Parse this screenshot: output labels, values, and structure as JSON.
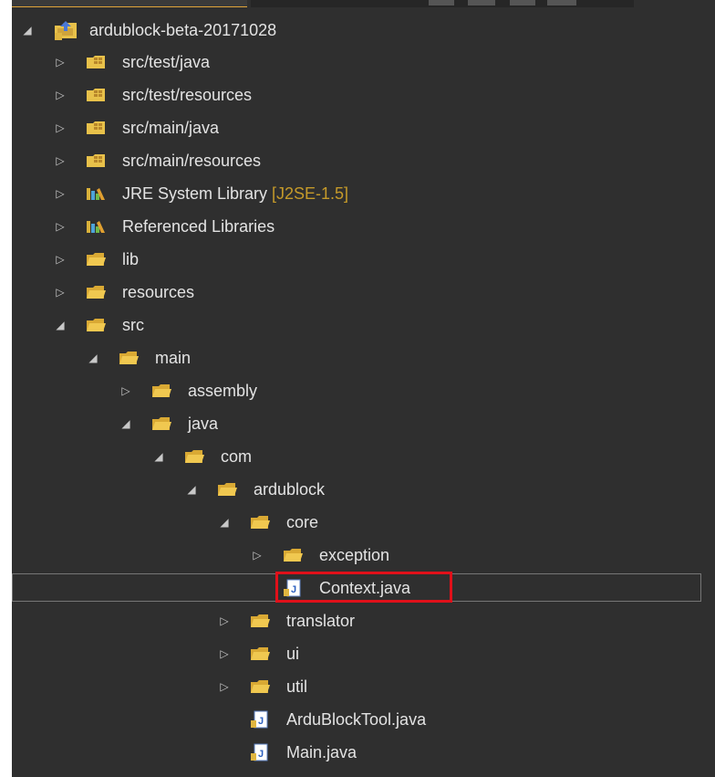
{
  "explorer": {
    "project": {
      "name": "ardublock-beta-20171028",
      "expanded": true
    },
    "rows": [
      {
        "label": "src/test/java",
        "icon": "package-folder-icon",
        "expanded": false
      },
      {
        "label": "src/test/resources",
        "icon": "package-folder-icon",
        "expanded": false
      },
      {
        "label": "src/main/java",
        "icon": "package-folder-icon",
        "expanded": false
      },
      {
        "label": "src/main/resources",
        "icon": "package-folder-icon",
        "expanded": false
      },
      {
        "label": "JRE System Library",
        "decoration": "[J2SE-1.5]",
        "icon": "library-icon",
        "expanded": false
      },
      {
        "label": "Referenced Libraries",
        "icon": "library-icon",
        "expanded": false
      },
      {
        "label": "lib",
        "icon": "folder-icon",
        "expanded": false
      },
      {
        "label": "resources",
        "icon": "folder-icon",
        "expanded": false
      },
      {
        "label": "src",
        "icon": "folder-icon",
        "expanded": true
      },
      {
        "label": "main",
        "icon": "folder-icon",
        "expanded": true
      },
      {
        "label": "assembly",
        "icon": "folder-icon",
        "expanded": false
      },
      {
        "label": "java",
        "icon": "folder-icon",
        "expanded": true
      },
      {
        "label": "com",
        "icon": "folder-icon",
        "expanded": true
      },
      {
        "label": "ardublock",
        "icon": "folder-icon",
        "expanded": true
      },
      {
        "label": "core",
        "icon": "folder-icon",
        "expanded": true
      },
      {
        "label": "exception",
        "icon": "folder-icon",
        "expanded": false
      },
      {
        "label": "Context.java",
        "icon": "java-file-icon",
        "selected": true
      },
      {
        "label": "translator",
        "icon": "folder-icon",
        "expanded": false
      },
      {
        "label": "ui",
        "icon": "folder-icon",
        "expanded": false
      },
      {
        "label": "util",
        "icon": "folder-icon",
        "expanded": false
      },
      {
        "label": "ArduBlockTool.java",
        "icon": "java-file-icon"
      },
      {
        "label": "Main.java",
        "icon": "java-file-icon"
      }
    ]
  },
  "colors": {
    "background": "#2f2f2f",
    "text": "#e3e3e3",
    "decoration": "#c59a2a",
    "highlight": "#e0101a",
    "folder": "#e8c14a"
  }
}
